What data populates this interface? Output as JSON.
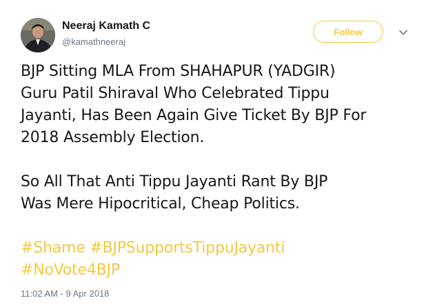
{
  "author": {
    "display_name": "Neeraj Kamath C",
    "handle": "@kamathneeraj"
  },
  "follow_label": "Follow",
  "tweet": {
    "paragraph1": [
      "BJP Sitting MLA From SHAHAPUR (YADGIR)",
      "Guru Patil Shiraval Who Celebrated Tippu",
      "Jayanti, Has Been Again Give Ticket By BJP For",
      "2018 Assembly Election."
    ],
    "paragraph2": [
      "So All That Anti Tippu Jayanti Rant By BJP",
      "Was Mere Hipocritical, Cheap Politics."
    ],
    "hashtags": [
      "#Shame",
      "#BJPSupportsTippuJayanti",
      "#NoVote4BJP"
    ]
  },
  "timestamp": "11:02 AM - 9 Apr 2018",
  "icons": {
    "caret": "chevron-down-icon",
    "avatar": "avatar"
  },
  "colors": {
    "accent": "#f5c93d",
    "text": "#14171a",
    "secondary": "#657786"
  }
}
